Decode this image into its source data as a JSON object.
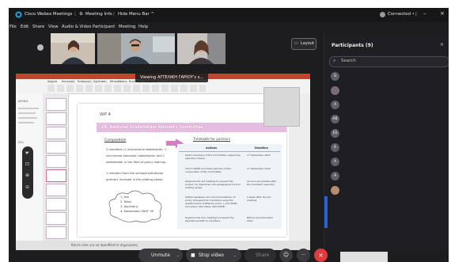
{
  "titlebar": {
    "app_title": "Cisco Webex Meetings",
    "meeting_info": "Meeting Info",
    "hide_menu": "Hide Menu Bar ^",
    "status": "Connected •"
  },
  "menubar": {
    "items": [
      "File",
      "Edit",
      "Share",
      "View",
      "Audio & Video",
      "Participant",
      "Meeting",
      "Help"
    ]
  },
  "layout_button": "Layout",
  "participants": {
    "title": "Participants (9)",
    "search_placeholder": "Search",
    "avatars": [
      "S",
      "",
      "A",
      "AB",
      "ES",
      "A",
      "A",
      "A",
      ""
    ]
  },
  "viewing_banner": "Viewing ΑΓΓΕΛΙΚΗ ΓΑΡΙΟΥ's s...",
  "slide": {
    "wp": "WP 4",
    "heading": "28. National Stakeholder Advisory Committee",
    "composition_label": "Composition",
    "composition_text": [
      "3 members (1 educational stakeholder, 1",
      "non-formal education stakeholder and 1",
      "stakeholder in the field of policy making).",
      "",
      "1 member from the school/institutional",
      "partners involved in the piloting phase."
    ],
    "cloud_items": [
      "1. Κοκ",
      "2. Νέρα",
      "3. Δημήτρης",
      "4. Μανουσάκη ΕΝΟΓ 99"
    ],
    "timetable_label": "Timetable for partners",
    "table_header": [
      "Actions",
      "Deadline"
    ],
    "table_rows": [
      [
        "Select members of the Committee, respecting selection criteria",
        "17 September 2022"
      ],
      [
        "Inform NCER and other partners of the composition of the Committee",
        "17 September 2022"
      ],
      [
        "Organize the 1st meeting to present the project, its objectives, the pedagogical kit and piloting phase",
        "As soon as possible after the members' selection"
      ],
      [
        "Gather feedback and recommendations of policy changes from members using the questionnaire drafted by Inovo + and NCER and share information with NCER",
        "1 week after the 1st meeting"
      ],
      [
        "Organize the 2nd meeting to present the Operational Path to members",
        "Before end November 2022"
      ]
    ]
  },
  "share_status_text": "Κάντε κλικ για να προσθέσετε σημειώσεις",
  "share_ribbon_tabs": [
    "Αρχείο",
    "Κεντρική",
    "Εισαγωγή",
    "Σχεδίαση",
    "Μεταβάσεις",
    "Κινήσεις",
    "Προβολή"
  ],
  "share_left_labels": [
    "ΑΡΧΙΚΗ",
    "ΕΛΛ"
  ],
  "controls": {
    "unmute": "Unmute",
    "stop_video": "Stop video",
    "share": "Share",
    "more": "···"
  },
  "colors": {
    "accent_pink": "#c8568c",
    "banner_pink": "#e4bde0",
    "end_red": "#e03a3a",
    "mute_red": "#e24a4a"
  }
}
